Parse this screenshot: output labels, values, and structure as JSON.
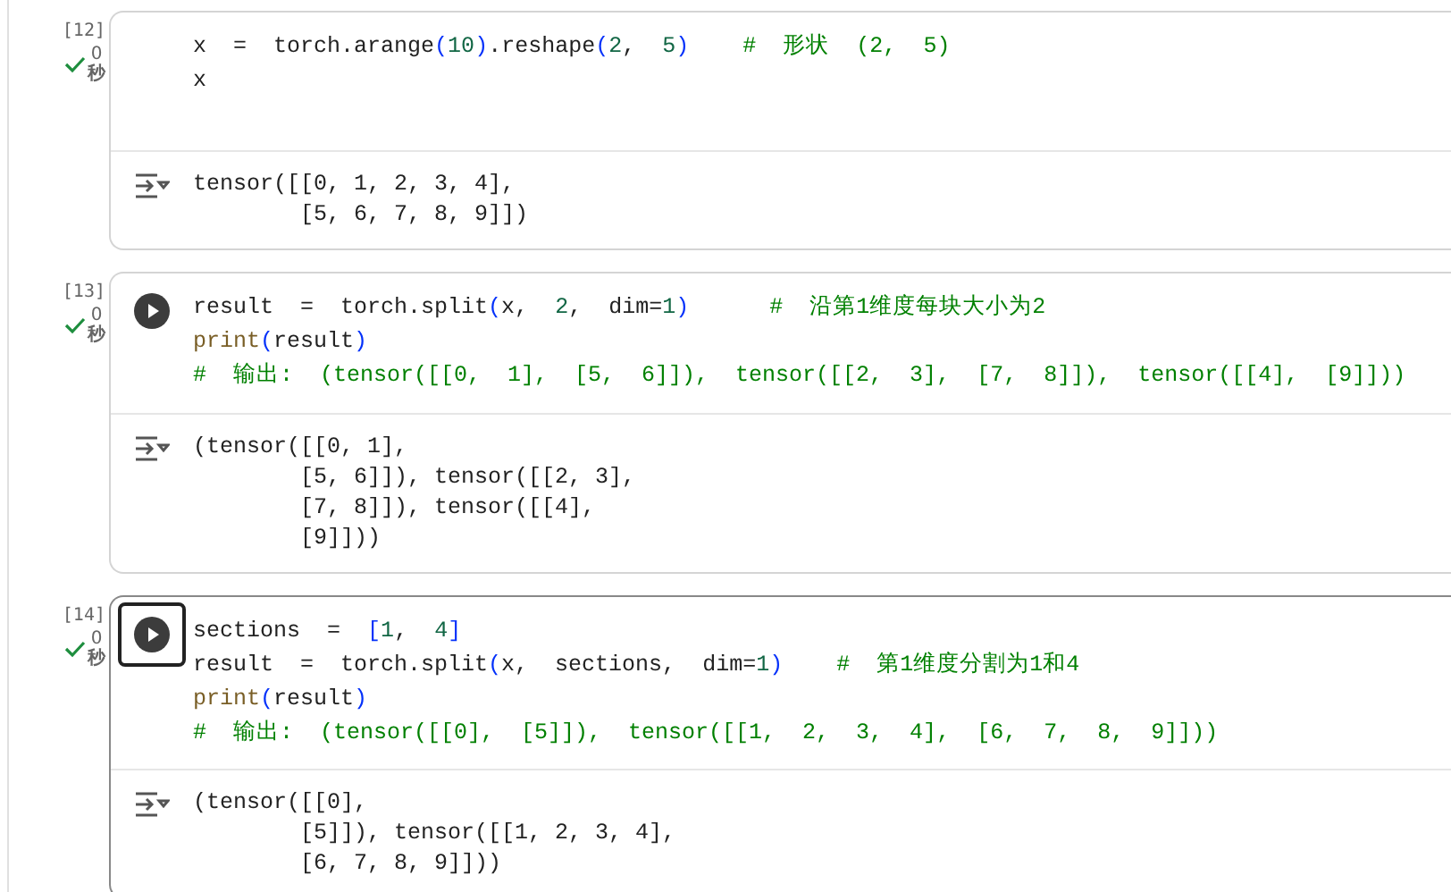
{
  "cells": [
    {
      "count": "[12]",
      "completed": true,
      "time": "0",
      "unit": "秒",
      "run_button": false,
      "focused": false,
      "code": [
        [
          {
            "kind": "plain",
            "t": "x  =  torch.arange"
          },
          {
            "kind": "bracket",
            "t": "("
          },
          {
            "kind": "num",
            "t": "10"
          },
          {
            "kind": "bracket",
            "t": ")"
          },
          {
            "kind": "plain",
            "t": ".reshape"
          },
          {
            "kind": "bracket",
            "t": "("
          },
          {
            "kind": "num",
            "t": "2"
          },
          {
            "kind": "plain",
            "t": ",  "
          },
          {
            "kind": "num",
            "t": "5"
          },
          {
            "kind": "bracket",
            "t": ")"
          },
          {
            "kind": "comment",
            "t": "    #  形状  (2,  5)"
          }
        ],
        [
          {
            "kind": "plain",
            "t": "x"
          }
        ]
      ],
      "output": [
        "tensor([[0, 1, 2, 3, 4],",
        "        [5, 6, 7, 8, 9]])"
      ]
    },
    {
      "count": "[13]",
      "completed": true,
      "time": "0",
      "unit": "秒",
      "run_button": true,
      "focused": false,
      "code": [
        [
          {
            "kind": "plain",
            "t": "result  =  torch.split"
          },
          {
            "kind": "bracket",
            "t": "("
          },
          {
            "kind": "plain",
            "t": "x,  "
          },
          {
            "kind": "num",
            "t": "2"
          },
          {
            "kind": "plain",
            "t": ",  dim="
          },
          {
            "kind": "num",
            "t": "1"
          },
          {
            "kind": "bracket",
            "t": ")"
          },
          {
            "kind": "comment",
            "t": "      #  沿第1维度每块大小为2"
          }
        ],
        [
          {
            "kind": "builtin",
            "t": "print"
          },
          {
            "kind": "bracket",
            "t": "("
          },
          {
            "kind": "plain",
            "t": "result"
          },
          {
            "kind": "bracket",
            "t": ")"
          }
        ],
        [
          {
            "kind": "comment",
            "t": "#  输出:  (tensor([[0,  1],  [5,  6]]),  tensor([[2,  3],  [7,  8]]),  tensor([[4],  [9]]))"
          }
        ]
      ],
      "output": [
        "(tensor([[0, 1],",
        "        [5, 6]]), tensor([[2, 3],",
        "        [7, 8]]), tensor([[4],",
        "        [9]]))"
      ]
    },
    {
      "count": "[14]",
      "completed": true,
      "time": "0",
      "unit": "秒",
      "run_button": true,
      "focused": true,
      "code": [
        [
          {
            "kind": "plain",
            "t": "sections  =  "
          },
          {
            "kind": "bracket",
            "t": "["
          },
          {
            "kind": "num",
            "t": "1"
          },
          {
            "kind": "plain",
            "t": ",  "
          },
          {
            "kind": "num",
            "t": "4"
          },
          {
            "kind": "bracket",
            "t": "]"
          }
        ],
        [
          {
            "kind": "plain",
            "t": "result  =  torch.split"
          },
          {
            "kind": "bracket",
            "t": "("
          },
          {
            "kind": "plain",
            "t": "x,  sections,  dim="
          },
          {
            "kind": "num",
            "t": "1"
          },
          {
            "kind": "bracket",
            "t": ")"
          },
          {
            "kind": "comment",
            "t": "    #  第1维度分割为1和4"
          }
        ],
        [
          {
            "kind": "builtin",
            "t": "print"
          },
          {
            "kind": "bracket",
            "t": "("
          },
          {
            "kind": "plain",
            "t": "result"
          },
          {
            "kind": "bracket",
            "t": ")"
          }
        ],
        [
          {
            "kind": "comment",
            "t": "#  输出:  (tensor([[0],  [5]]),  tensor([[1,  2,  3,  4],  [6,  7,  8,  9]]))"
          }
        ]
      ],
      "output": [
        "(tensor([[0],",
        "        [5]]), tensor([[1, 2, 3, 4],",
        "        [6, 7, 8, 9]]))"
      ]
    }
  ]
}
